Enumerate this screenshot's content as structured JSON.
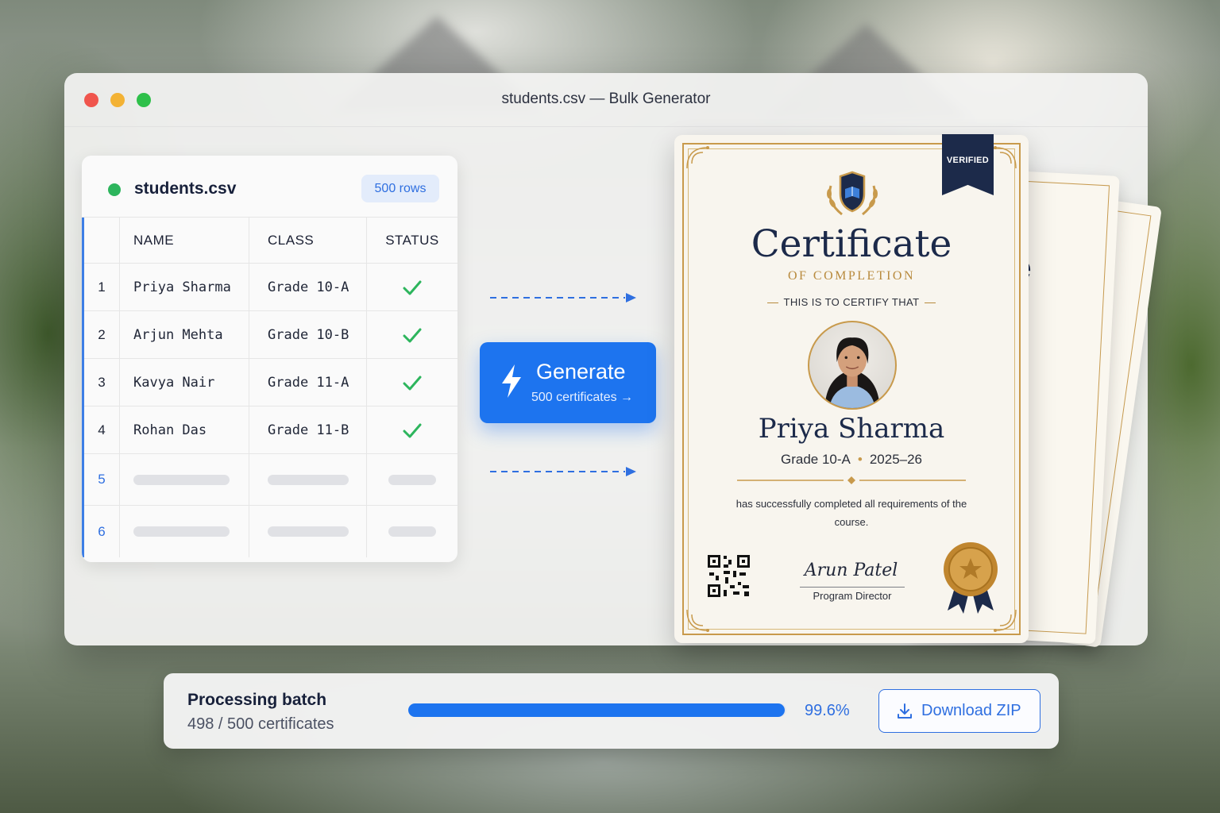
{
  "window": {
    "title": "students.csv — Bulk Generator"
  },
  "csv_card": {
    "file_name": "students.csv",
    "rows_badge": "500 rows",
    "columns": [
      "NAME",
      "CLASS",
      "STATUS"
    ],
    "rows": [
      {
        "index": "1",
        "name": "Priya Sharma",
        "class": "Grade 10-A",
        "status": "check-icon"
      },
      {
        "index": "2",
        "name": "Arjun Mehta",
        "class": "Grade 10-B",
        "status": "check-icon"
      },
      {
        "index": "3",
        "name": "Kavya Nair",
        "class": "Grade 11-A",
        "status": "check-icon"
      },
      {
        "index": "4",
        "name": "Rohan Das",
        "class": "Grade 11-B",
        "status": "check-icon"
      }
    ],
    "placeholder_rows": [
      "5",
      "6"
    ]
  },
  "generate_button": {
    "label": "Generate",
    "sub_label": "500 certificates →",
    "icon": "lightning-bolt-icon"
  },
  "certificate": {
    "ribbon": "VERIFIED",
    "title": "Certificate",
    "subtitle": "OF COMPLETION",
    "certify_line": "THIS IS TO CERTIFY THAT",
    "recipient_name": "Priya Sharma",
    "grade": "Grade 10-A",
    "year": "2025–26",
    "body": "has successfully completed all requirements of the course.",
    "signature": "Arun Patel",
    "signatory_title": "Program Director",
    "back_card_fragment": "e"
  },
  "progress": {
    "title": "Processing batch",
    "count": "498 / 500 certificates",
    "percent_label": "99.6%",
    "fraction": 0.996,
    "download_label": "Download ZIP"
  },
  "colors": {
    "accent": "#1d74ef",
    "success": "#2db55d",
    "gold": "#c89a4c",
    "navy": "#1c2a4a"
  }
}
